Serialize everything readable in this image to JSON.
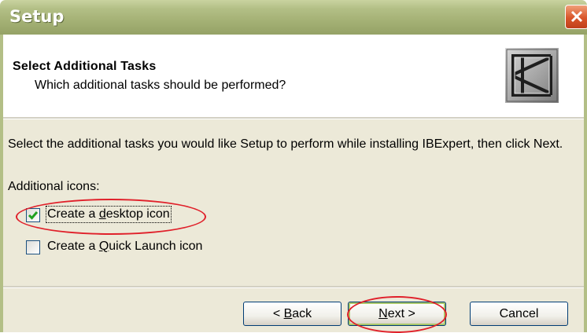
{
  "window": {
    "title": "Setup"
  },
  "header": {
    "title": "Select Additional Tasks",
    "subtitle": "Which additional tasks should be performed?"
  },
  "content": {
    "description": "Select the additional tasks you would like Setup to perform while installing IBExpert, then  click Next.",
    "group_label": "Additional icons:",
    "tasks": [
      {
        "pre": "Create a ",
        "accel": "d",
        "post": "esktop icon",
        "checked": true
      },
      {
        "pre": "Create a ",
        "accel": "Q",
        "post": "uick Launch icon",
        "checked": false
      }
    ]
  },
  "buttons": {
    "back": {
      "pre": "< ",
      "accel": "B",
      "post": "ack"
    },
    "next": {
      "pre": "",
      "accel": "N",
      "post": "ext >"
    },
    "cancel": {
      "label": "Cancel"
    }
  },
  "colors": {
    "titlebar": "#a4b175",
    "dialog_bg": "#ece9d8",
    "checkmark": "#21a121",
    "highlight": "#e0202a"
  }
}
